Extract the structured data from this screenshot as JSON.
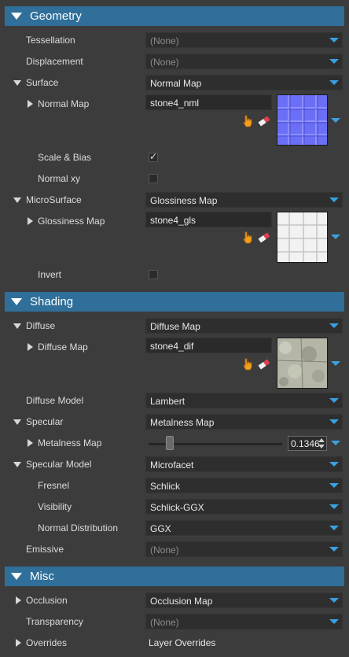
{
  "sections": {
    "geometry": "Geometry",
    "shading": "Shading",
    "misc": "Misc"
  },
  "geometry": {
    "tessellation": {
      "label": "Tessellation",
      "value": "(None)"
    },
    "displacement": {
      "label": "Displacement",
      "value": "(None)"
    },
    "surface": {
      "label": "Surface",
      "value": "Normal Map"
    },
    "normal_map": {
      "label": "Normal Map",
      "texture": "stone4_nml"
    },
    "scale_bias": {
      "label": "Scale & Bias",
      "checked": true,
      "mark": "✓"
    },
    "normal_xy": {
      "label": "Normal xy",
      "checked": false
    },
    "microsurface": {
      "label": "MicroSurface",
      "value": "Glossiness Map"
    },
    "glossiness_map": {
      "label": "Glossiness Map",
      "texture": "stone4_gls"
    },
    "invert": {
      "label": "Invert",
      "checked": false
    }
  },
  "shading": {
    "diffuse": {
      "label": "Diffuse",
      "value": "Diffuse Map"
    },
    "diffuse_map": {
      "label": "Diffuse Map",
      "texture": "stone4_dif"
    },
    "diffuse_model": {
      "label": "Diffuse Model",
      "value": "Lambert"
    },
    "specular": {
      "label": "Specular",
      "value": "Metalness Map"
    },
    "metalness_map": {
      "label": "Metalness Map",
      "value": "0.1346",
      "slider_fraction": 0.1346
    },
    "specular_model": {
      "label": "Specular Model",
      "value": "Microfacet"
    },
    "fresnel": {
      "label": "Fresnel",
      "value": "Schlick"
    },
    "visibility": {
      "label": "Visibility",
      "value": "Schlick-GGX"
    },
    "normal_distribution": {
      "label": "Normal Distribution",
      "value": "GGX"
    },
    "emissive": {
      "label": "Emissive",
      "value": "(None)"
    }
  },
  "misc": {
    "occlusion": {
      "label": "Occlusion",
      "value": "Occlusion Map"
    },
    "transparency": {
      "label": "Transparency",
      "value": "(None)"
    },
    "overrides": {
      "label": "Overrides",
      "value": "Layer Overrides"
    }
  },
  "colors": {
    "header": "#2f6f99",
    "accent_arrow": "#3aa0e0",
    "background": "#3c3c3c"
  },
  "icons": {
    "pick": "hand-pointer-icon",
    "clear": "eraser-icon"
  }
}
